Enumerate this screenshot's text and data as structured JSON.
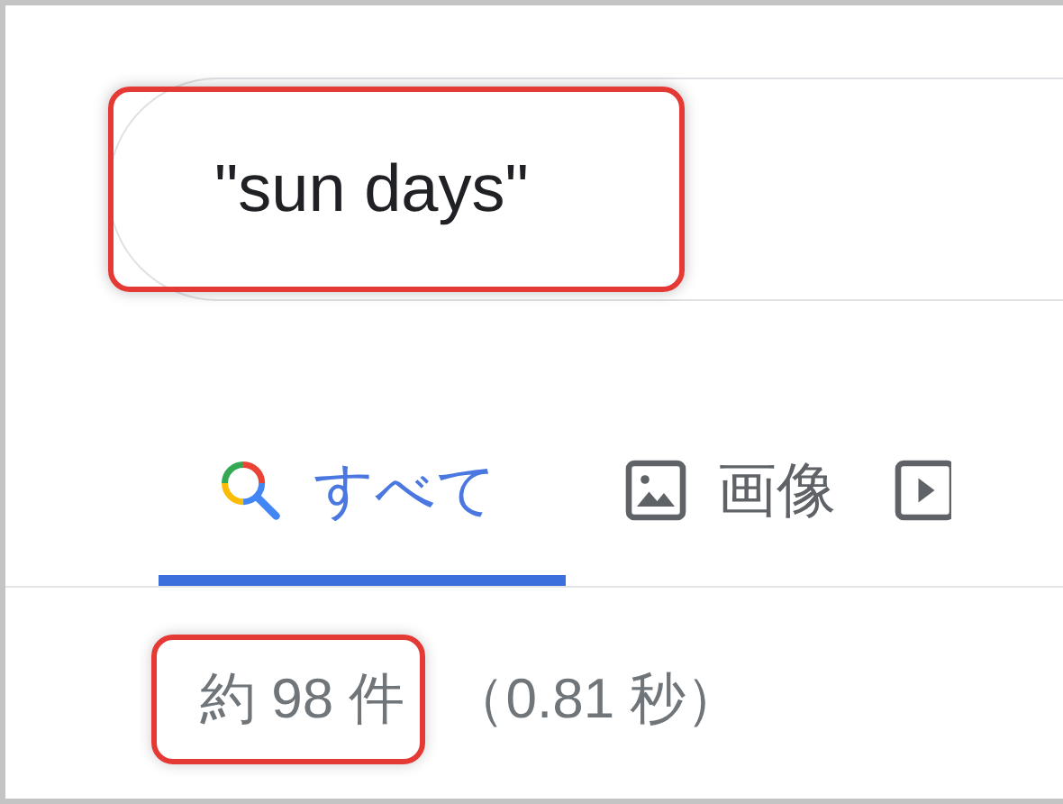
{
  "search": {
    "query": "\"sun days\"",
    "highlighted": true
  },
  "tabs": [
    {
      "kind": "all",
      "label": "すべて",
      "selected": true
    },
    {
      "kind": "images",
      "label": "画像",
      "selected": false
    },
    {
      "kind": "videos",
      "selected": false
    }
  ],
  "result_stats": {
    "count": "約 98 件",
    "count_highlighted": true,
    "time": "（0.81 秒）"
  }
}
